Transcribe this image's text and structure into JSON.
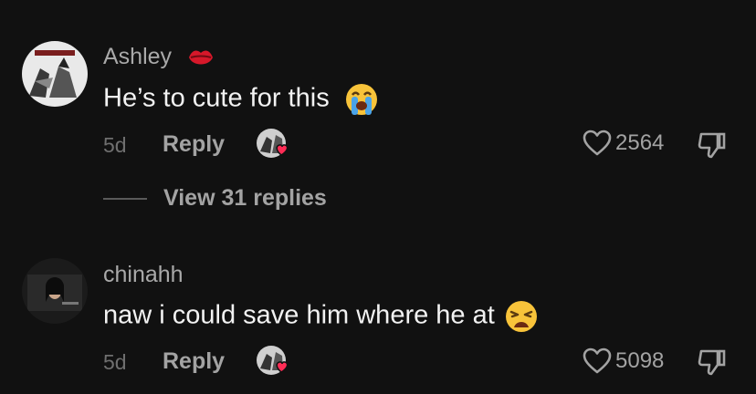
{
  "comments": [
    {
      "username": "Ashley",
      "username_icon": "lips-icon",
      "text": "He’s to cute for this",
      "text_emoji": "loudly-crying-face-icon",
      "time": "5d",
      "reply_label": "Reply",
      "likes": "2564",
      "view_replies": "View 31 replies"
    },
    {
      "username": "chinahh",
      "text": "naw i could save him where he at",
      "text_emoji": "weary-face-icon",
      "time": "5d",
      "reply_label": "Reply",
      "likes": "5098"
    }
  ],
  "colors": {
    "background": "#111111",
    "heart": "#fe2c55",
    "muted_text": "#a3a3a3"
  }
}
